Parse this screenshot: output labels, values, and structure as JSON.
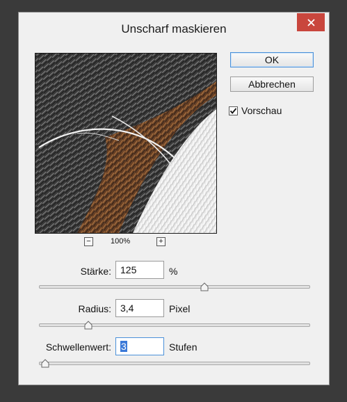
{
  "dialog": {
    "title": "Unscharf maskieren",
    "close_icon": "close-icon"
  },
  "buttons": {
    "ok_label": "OK",
    "cancel_label": "Abbrechen"
  },
  "preview_checkbox": {
    "label": "Vorschau",
    "checked": true
  },
  "zoom": {
    "value": "100%",
    "zoom_out_icon": "minus-icon",
    "zoom_in_icon": "plus-icon"
  },
  "params": {
    "amount": {
      "label": "Stärke:",
      "value": "125",
      "unit": "%",
      "slider_fraction": 0.61
    },
    "radius": {
      "label": "Radius:",
      "value": "3,4",
      "unit": "Pixel",
      "slider_fraction": 0.18
    },
    "threshold": {
      "label": "Schwellenwert:",
      "value": "3",
      "unit": "Stufen",
      "slider_fraction": 0.02
    }
  },
  "colors": {
    "close_red": "#c9463d",
    "focus_blue": "#4a90d9",
    "selection_blue": "#3a79d8"
  }
}
